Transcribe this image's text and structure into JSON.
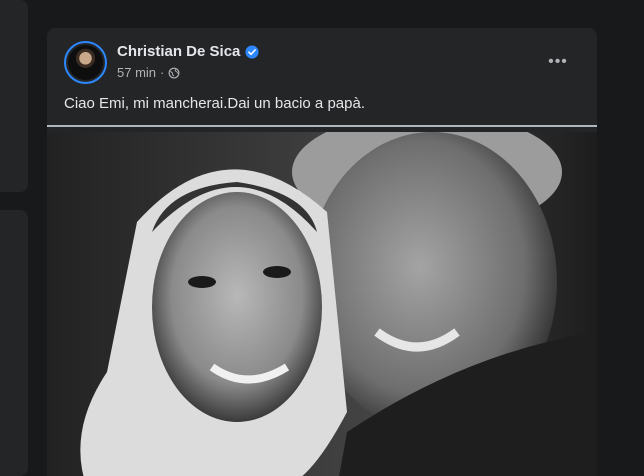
{
  "post": {
    "author": "Christian De Sica",
    "timestamp": "57 min",
    "separator": "·",
    "text": "Ciao Emi, mi mancherai.Dai un bacio a papà.",
    "more_label": "•••"
  },
  "colors": {
    "background": "#18191a",
    "card": "#242526",
    "accent": "#2d88ff",
    "text_primary": "#e4e6eb",
    "text_secondary": "#b0b3b8"
  },
  "icons": {
    "verified": "verified-badge-icon",
    "audience": "globe-icon",
    "more": "more-options-icon"
  }
}
